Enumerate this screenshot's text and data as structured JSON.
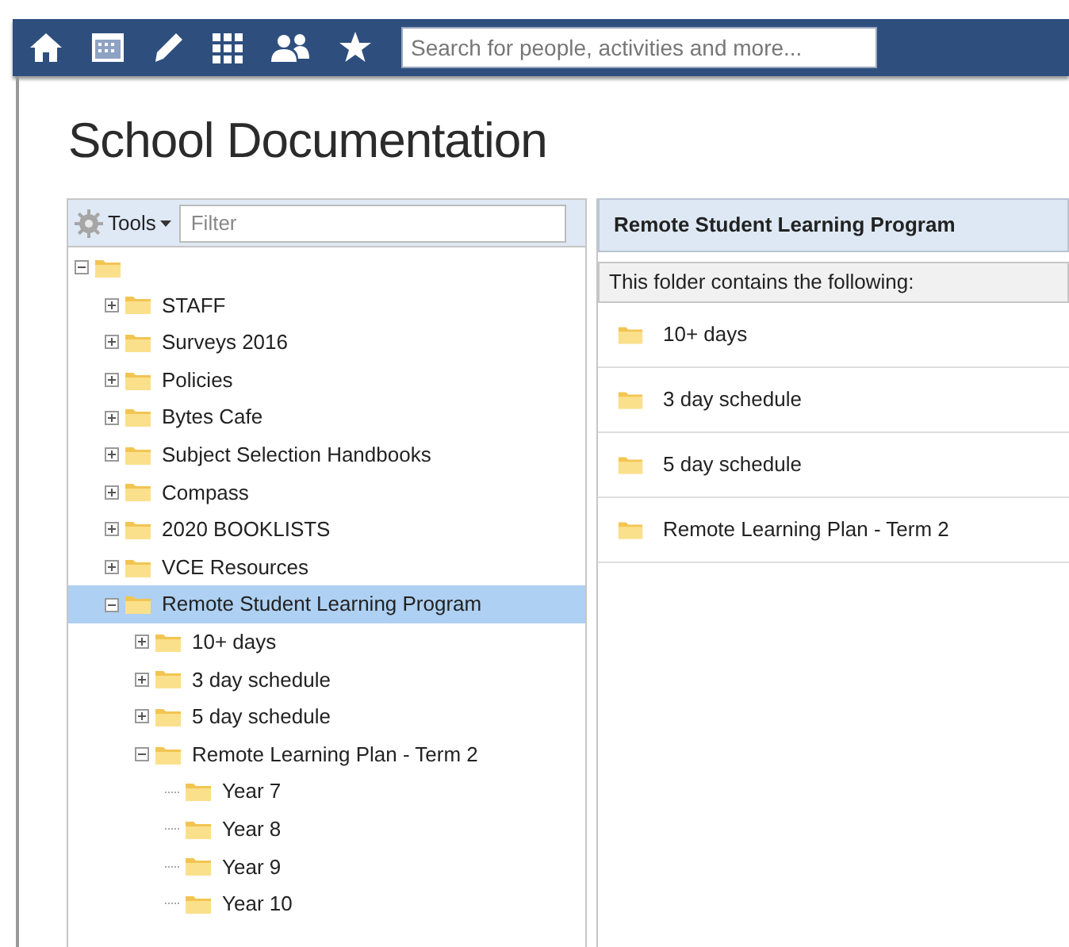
{
  "top_bar": {
    "search": {
      "placeholder": "Search for people, activities and more..."
    }
  },
  "page_title": "School Documentation",
  "tree_panel": {
    "tools_label": "Tools",
    "filter": {
      "placeholder": "Filter"
    },
    "tree": [
      {
        "expanded": true,
        "selected": false,
        "children": [
          {
            "label": "STAFF",
            "expanded": false,
            "selected": false
          },
          {
            "label": "Surveys 2016",
            "expanded": false,
            "selected": false
          },
          {
            "label": "Policies",
            "expanded": false,
            "selected": false
          },
          {
            "label": "Bytes Cafe",
            "expanded": false,
            "selected": false
          },
          {
            "label": "Subject Selection Handbooks",
            "expanded": false,
            "selected": false
          },
          {
            "label": "Compass",
            "expanded": false,
            "selected": false
          },
          {
            "label": "2020 BOOKLISTS",
            "expanded": false,
            "selected": false
          },
          {
            "label": "VCE Resources",
            "expanded": false,
            "selected": false
          },
          {
            "label": "Remote Student Learning Program",
            "expanded": true,
            "selected": true,
            "children": [
              {
                "label": "10+ days",
                "expanded": false,
                "selected": false
              },
              {
                "label": "3 day schedule",
                "expanded": false,
                "selected": false
              },
              {
                "label": "5 day schedule",
                "expanded": false,
                "selected": false
              },
              {
                "label": "Remote Learning Plan - Term 2",
                "expanded": true,
                "selected": false,
                "children": [
                  {
                    "label": "Year 7",
                    "selected": false
                  },
                  {
                    "label": "Year 8",
                    "selected": false
                  },
                  {
                    "label": "Year 9",
                    "selected": false
                  },
                  {
                    "label": "Year 10",
                    "selected": false
                  }
                ]
              }
            ]
          }
        ]
      }
    ]
  },
  "content_panel": {
    "title": "Remote Student Learning Program",
    "caption": "This folder contains the following:",
    "items": [
      "10+ days",
      "3 day schedule",
      "5 day schedule",
      "Remote Learning Plan - Term 2"
    ]
  }
}
